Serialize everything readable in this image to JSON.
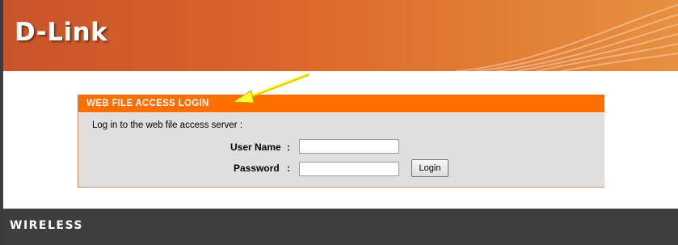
{
  "header": {
    "brand": "D-Link",
    "colors": {
      "start": "#c8542a",
      "end": "#e69040"
    }
  },
  "login_panel": {
    "title": "WEB FILE ACCESS LOGIN",
    "intro": "Log in to the web file access server :",
    "username_label": "User Name",
    "password_label": "Password",
    "separator": ":",
    "username_value": "",
    "password_value": "",
    "login_button": "Login",
    "accent_color": "#ff6f00"
  },
  "annotation": {
    "icon": "yellow-arrow-icon"
  },
  "footer": {
    "text": "WIRELESS"
  }
}
